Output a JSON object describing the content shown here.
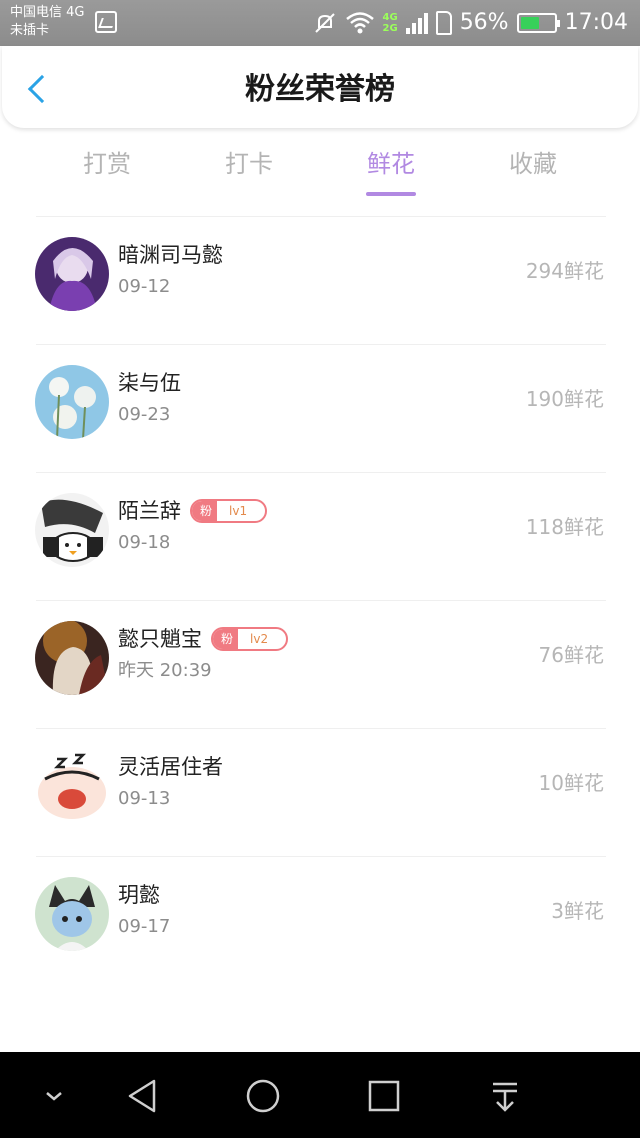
{
  "status_bar": {
    "carrier_line1": "中国电信 4G",
    "carrier_line2": "未插卡",
    "net_4g": "4G",
    "net_2g": "2G",
    "battery_percent": "56%",
    "battery_level": 0.56,
    "time": "17:04",
    "icons": [
      "image-icon",
      "mute-icon",
      "wifi-icon",
      "signal-icon",
      "sim-icon",
      "battery-icon"
    ]
  },
  "header": {
    "title": "粉丝荣誉榜",
    "back_icon": "chevron-left-icon"
  },
  "tabs": [
    {
      "label": "打赏",
      "active": false
    },
    {
      "label": "打卡",
      "active": false
    },
    {
      "label": "鲜花",
      "active": true
    },
    {
      "label": "收藏",
      "active": false
    }
  ],
  "colors": {
    "accent": "#b189e2",
    "back": "#2aa3e6",
    "badge": "#f07a82",
    "badge_level_text": "#e38a4c"
  },
  "fans": [
    {
      "name": "暗渊司马懿",
      "date": "09-12",
      "count": "294鲜花",
      "badge": null
    },
    {
      "name": "柒与伍",
      "date": "09-23",
      "count": "190鲜花",
      "badge": null
    },
    {
      "name": "陌兰辞",
      "date": "09-18",
      "count": "118鲜花",
      "badge": {
        "label": "粉",
        "level": "lv1"
      }
    },
    {
      "name": "懿只魈宝",
      "date": "昨天 20:39",
      "count": "76鲜花",
      "badge": {
        "label": "粉",
        "level": "lv2"
      }
    },
    {
      "name": "灵活居住者",
      "date": "09-13",
      "count": "10鲜花",
      "badge": null
    },
    {
      "name": "玥懿",
      "date": "09-17",
      "count": "3鲜花",
      "badge": null
    }
  ],
  "nav_bar": {
    "buttons": [
      "collapse-icon",
      "back-triangle-icon",
      "home-circle-icon",
      "recents-square-icon",
      "notification-pull-icon"
    ]
  }
}
